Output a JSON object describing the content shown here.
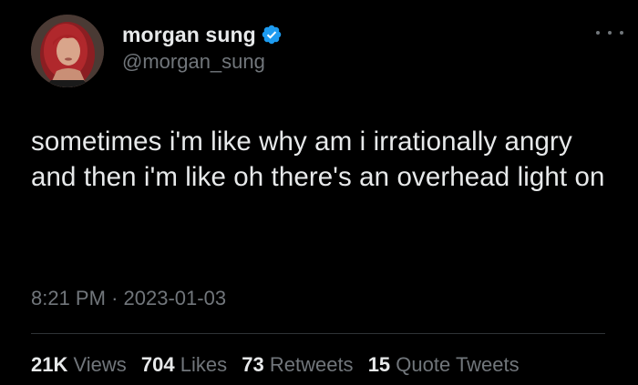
{
  "tweet": {
    "display_name": "morgan sung",
    "handle": "@morgan_sung",
    "verified_icon": "verified-badge-icon",
    "more_icon": "more-options-icon",
    "text": "sometimes i'm like why am i irrationally angry and then i'm like oh there's an overhead light on",
    "time": "8:21 PM",
    "separator": "·",
    "date": "2023-01-03",
    "stats": {
      "views_count": "21K",
      "views_label": "Views",
      "likes_count": "704",
      "likes_label": "Likes",
      "retweets_count": "73",
      "retweets_label": "Retweets",
      "quotes_count": "15",
      "quotes_label": "Quote Tweets"
    }
  },
  "colors": {
    "background": "#000000",
    "text_primary": "#e7e9ea",
    "text_secondary": "#71767b",
    "verified_blue": "#1d9bf0",
    "divider": "#2f3336"
  }
}
